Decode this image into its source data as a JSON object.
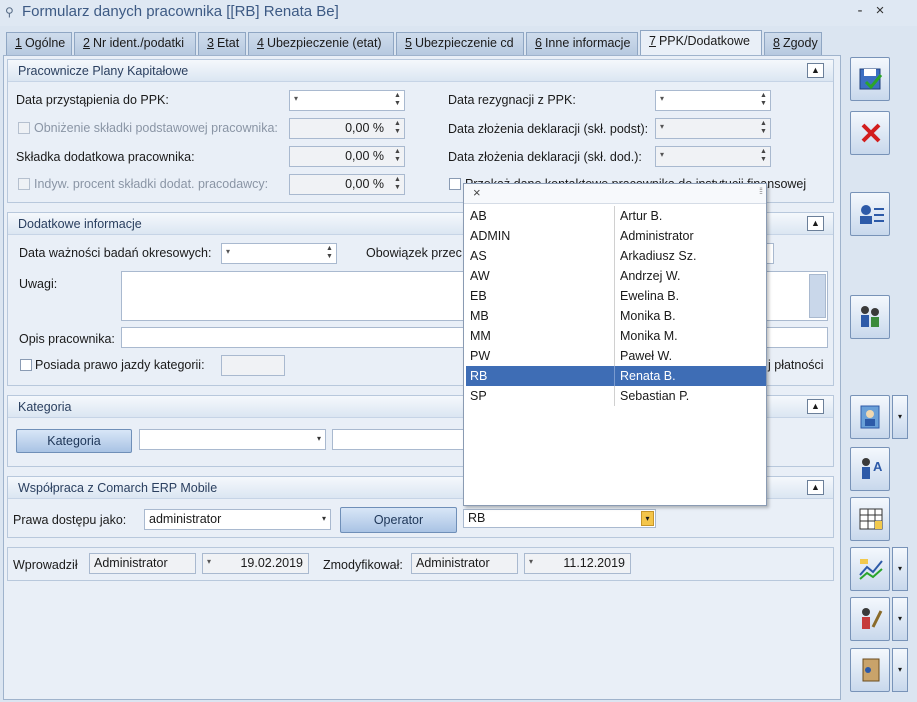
{
  "window": {
    "title": "Formularz danych pracownika [[RB] Renata Be]",
    "minimize": "-",
    "close": "×"
  },
  "tabs": [
    {
      "num": "1",
      "label": "Ogólne"
    },
    {
      "num": "2",
      "label": "Nr ident./podatki"
    },
    {
      "num": "3",
      "label": "Etat"
    },
    {
      "num": "4",
      "label": "Ubezpieczenie (etat)"
    },
    {
      "num": "5",
      "label": "Ubezpieczenie cd"
    },
    {
      "num": "6",
      "label": "Inne informacje"
    },
    {
      "num": "7",
      "label": "PPK/Dodatkowe"
    },
    {
      "num": "8",
      "label": "Zgody"
    }
  ],
  "ppk": {
    "title": "Pracownicze Plany Kapitałowe",
    "data_przystapienia_label": "Data przystąpienia do PPK:",
    "obnizenie_label": "Obniżenie składki podstawowej pracownika:",
    "obnizenie_value": "0,00 %",
    "skladka_dod_label": "Składka dodatkowa pracownika:",
    "skladka_dod_value": "0,00 %",
    "indyw_label": "Indyw. procent składki dodat. pracodawcy:",
    "indyw_value": "0,00 %",
    "data_rezygnacji_label": "Data rezygnacji z PPK:",
    "data_zlozenia_podst_label": "Data złożenia deklaracji (skł. podst):",
    "data_zlozenia_dod_label": "Data złożenia deklaracji (skł. dod.):",
    "przekaz_label": "Przekaż dane kontaktowe pracownika do instytucji finansowej"
  },
  "dodatkowe": {
    "title": "Dodatkowe informacje",
    "data_waznosci_label": "Data ważności badań okresowych:",
    "obowiazek_label": "Obowiązek przec",
    "uwagi_label": "Uwagi:",
    "opis_label": "Opis pracownika:",
    "prawo_jazdy_label": "Posiada prawo jazdy kategorii:",
    "platnosci_label": "j płatności"
  },
  "kategoria": {
    "title": "Kategoria",
    "button": "Kategoria"
  },
  "mobile": {
    "title": "Współpraca z Comarch ERP Mobile",
    "prawa_label": "Prawa dostępu jako:",
    "prawa_value": "administrator",
    "operator_button": "Operator",
    "operator_value": "RB"
  },
  "footer": {
    "wprowadzil_label": "Wprowadził",
    "wprowadzil_value": "Administrator",
    "wprowadzil_date": "19.02.2019",
    "zmodyfikowal_label": "Zmodyfikował:",
    "zmodyfikowal_value": "Administrator",
    "zmodyfikowal_date": "11.12.2019"
  },
  "popup": {
    "close": "×",
    "rows": [
      {
        "code": "AB",
        "name": "Artur B."
      },
      {
        "code": "ADMIN",
        "name": "Administrator"
      },
      {
        "code": "AS",
        "name": "Arkadiusz Sz."
      },
      {
        "code": "AW",
        "name": "Andrzej W."
      },
      {
        "code": "EB",
        "name": "Ewelina B."
      },
      {
        "code": "MB",
        "name": "Monika B."
      },
      {
        "code": "MM",
        "name": "Monika M."
      },
      {
        "code": "PW",
        "name": "Paweł W."
      },
      {
        "code": "RB",
        "name": "Renata B."
      },
      {
        "code": "SP",
        "name": "Sebastian P."
      }
    ],
    "selected": "RB"
  },
  "sidebar_icons": [
    "save-icon",
    "cancel-icon",
    "employee-card-icon",
    "people-icon",
    "photo-icon",
    "text-icon",
    "table-icon",
    "chart-icon",
    "tools-icon",
    "door-icon"
  ]
}
